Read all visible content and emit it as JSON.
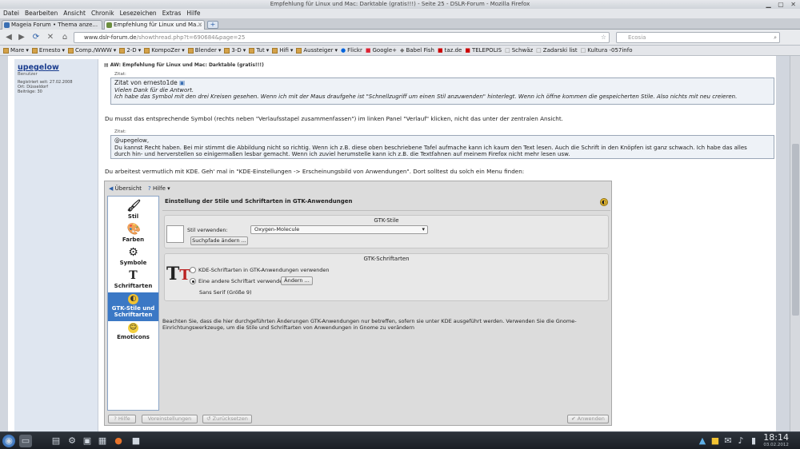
{
  "window": {
    "title": "Empfehlung für Linux und Mac: Darktable (gratis!!!) - Seite 25 - DSLR-Forum - Mozilla Firefox"
  },
  "menu": [
    "Datei",
    "Bearbeiten",
    "Ansicht",
    "Chronik",
    "Lesezeichen",
    "Extras",
    "Hilfe"
  ],
  "tabs": [
    {
      "label": "Mageia Forum • Thema anze..."
    },
    {
      "label": "Empfehlung für Linux und Ma..."
    }
  ],
  "nav": {
    "url_host": "www.dslr-forum.de",
    "url_path": "/showthread.php?t=690684&page=25",
    "search_placeholder": "Ecosia"
  },
  "bookmarks": [
    "Mare",
    "Ernesto",
    "Comp./WWW",
    "2-D",
    "KompoZer",
    "Blender",
    "3-D",
    "Tut",
    "Hifi",
    "Aussteiger",
    "Flickr",
    "Google+",
    "Babel Fish",
    "taz.de",
    "TELEPOLIS",
    "Schwäz",
    "Zadarski list",
    "Kultura -057info"
  ],
  "user": {
    "name": "upegelow",
    "title": "Benutzer",
    "registered": "Registriert seit: 27.02.2008",
    "location": "Ort: Düsseldorf",
    "posts": "Beiträge: 30"
  },
  "post": {
    "title": "AW: Empfehlung für Linux und Mac: Darktable (gratis!!!)",
    "quote1_label": "Zitat:",
    "quote1_from": "Zitat von ernesto1de",
    "quote1_line1": "Vielen Dank für die Antwort.",
    "quote1_line2": "Ich habe das Symbol mit den drei Kreisen gesehen. Wenn ich mit der Maus draufgehe ist \"Schnellzugriff um einen Stil anzuwenden\" hinterlegt. Wenn ich öffne kommen die gespeicherten Stile. Also nichts mit neu creieren.",
    "para1": "Du musst das entsprechende Symbol (rechts neben \"Verlaufsstapel zusammenfassen\") im linken Panel \"Verlauf\" klicken, nicht das unter der zentralen Ansicht.",
    "quote2_label": "Zitat:",
    "quote2_line1": "@upegelow,",
    "quote2_line2": "Du kannst Recht haben. Bei mir stimmt die Abbildung nicht so richtig. Wenn ich z.B. diese oben beschriebene Tafel aufmache kann ich kaum den Text lesen. Auch die Schrift in den Knöpfen ist ganz schwach. Ich habe das alles",
    "quote2_line3": "durch hin- und herverstellen so einigermaßen lesbar gemacht. Wenn ich zuviel herumstelle kann ich z.B. die Textfahnen auf meinem Firefox nicht mehr lesen usw.",
    "para2": "Du arbeitest vermutlich mit KDE. Geh' mal in \"KDE-Einstellungen -> Erscheinungsbild von Anwendungen\". Dort solltest du solch ein Menu finden:"
  },
  "kde": {
    "toolbar": {
      "overview": "Übersicht",
      "help": "Hilfe"
    },
    "sidebar": [
      {
        "label": "Stil",
        "icon": "brush-icon"
      },
      {
        "label": "Farben",
        "icon": "palette-icon"
      },
      {
        "label": "Symbole",
        "icon": "emblems-icon"
      },
      {
        "label": "Schriftarten",
        "icon": "font-icon"
      },
      {
        "label": "GTK-Stile und Schriftarten",
        "icon": "gtk-icon"
      },
      {
        "label": "Emoticons",
        "icon": "smiley-icon"
      }
    ],
    "heading": "Einstellung der Stile und Schriftarten in GTK-Anwendungen",
    "gtk_styles": {
      "title": "GTK-Stile",
      "style_label": "Stil verwenden:",
      "style_value": "Oxygen-Molecule",
      "search_paths_button": "Suchpfade ändern ..."
    },
    "gtk_fonts": {
      "title": "GTK-Schriftarten",
      "radio_kde": "KDE-Schriftarten in GTK-Anwendungen verwenden",
      "radio_other": "Eine andere Schriftart verwenden:",
      "change_button": "Ändern ...",
      "font_value": "Sans Serif (Größe 9)"
    },
    "note": "Beachten Sie, dass die hier durchgeführten Änderungen GTK-Anwendungen nur betreffen, sofern sie unter KDE ausgeführt werden. Verwenden Sie die Gnome-Einrichtungswerkzeuge, um die Stile und Schriftarten von Anwendungen in Gnome zu verändern",
    "buttons": {
      "help": "Hilfe",
      "defaults": "Voreinstellungen",
      "reset": "Zurücksetzen",
      "apply": "Anwenden"
    }
  },
  "taskbar": {
    "time": "18:14",
    "date": "03.02.2012"
  }
}
